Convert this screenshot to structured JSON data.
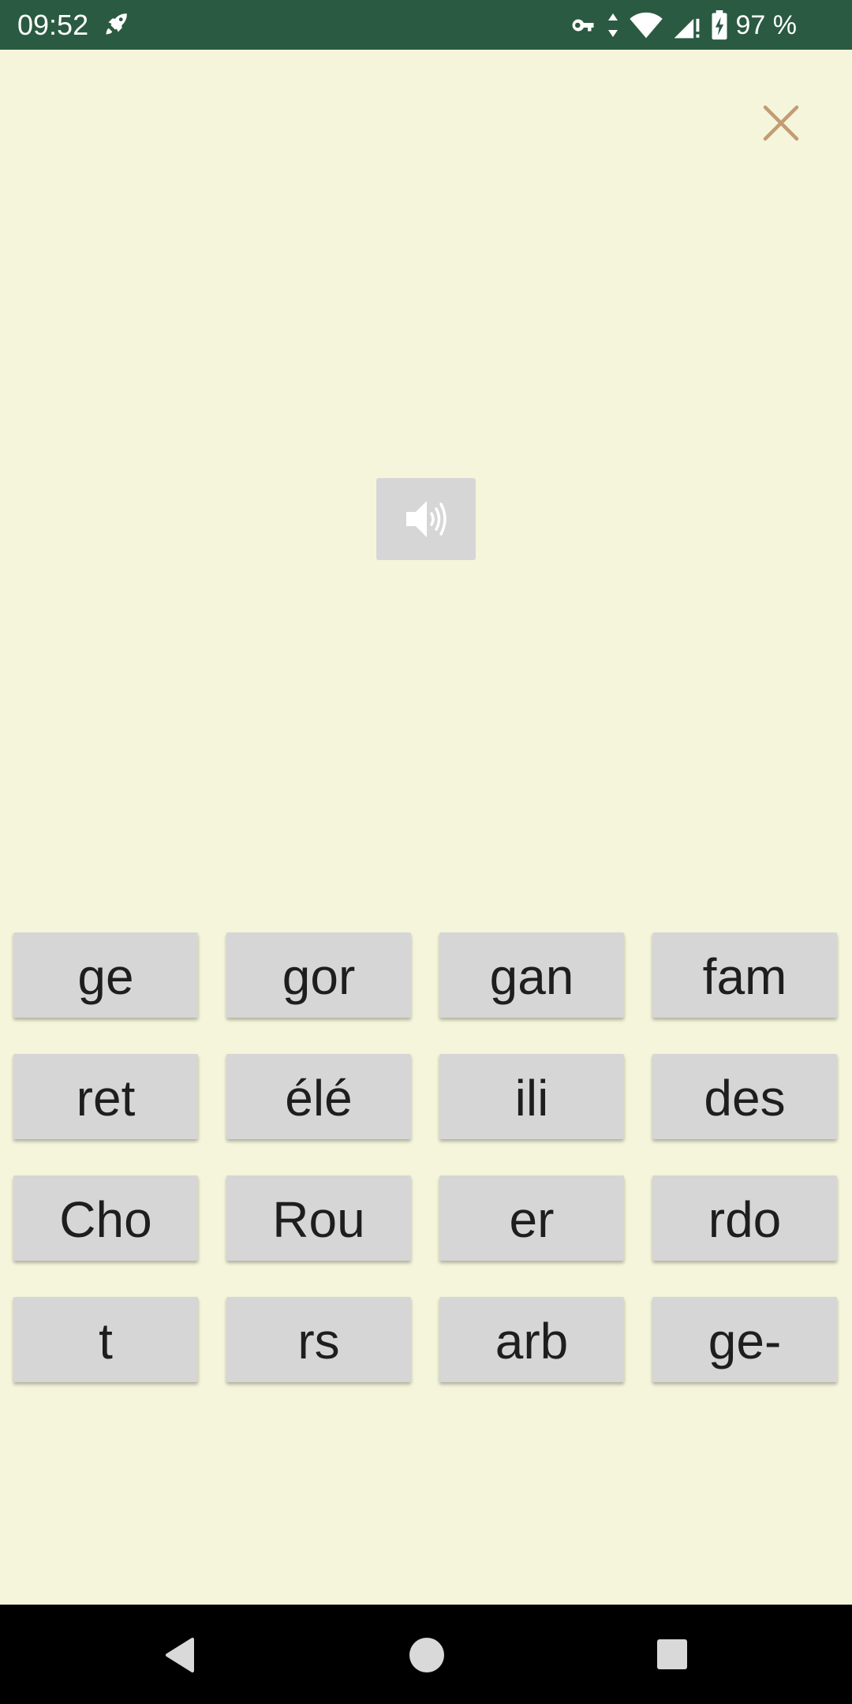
{
  "status_bar": {
    "time": "09:52",
    "battery_percent": "97 %",
    "icons": [
      "rocket-icon",
      "vpn-key-icon",
      "data-arrows-icon",
      "wifi-icon",
      "signal-icon",
      "battery-charging-icon"
    ]
  },
  "toolbar": {
    "close_icon": "close-icon"
  },
  "audio": {
    "speaker_icon": "speaker-icon"
  },
  "syllables": [
    [
      "ge",
      "gor",
      "gan",
      "fam"
    ],
    [
      "ret",
      "élé",
      "ili",
      "des"
    ],
    [
      "Cho",
      "Rou",
      "er",
      "rdo"
    ],
    [
      "t",
      "rs",
      "arb",
      "ge-"
    ]
  ],
  "nav_bar": {
    "icons": [
      "back-icon",
      "home-icon",
      "recents-icon"
    ]
  },
  "colors": {
    "status_bar": "#2a5a41",
    "background": "#f5f5dc",
    "tile": "#d6d6d6",
    "close_accent": "#c39c72",
    "tile_text": "#1e1e1e"
  }
}
